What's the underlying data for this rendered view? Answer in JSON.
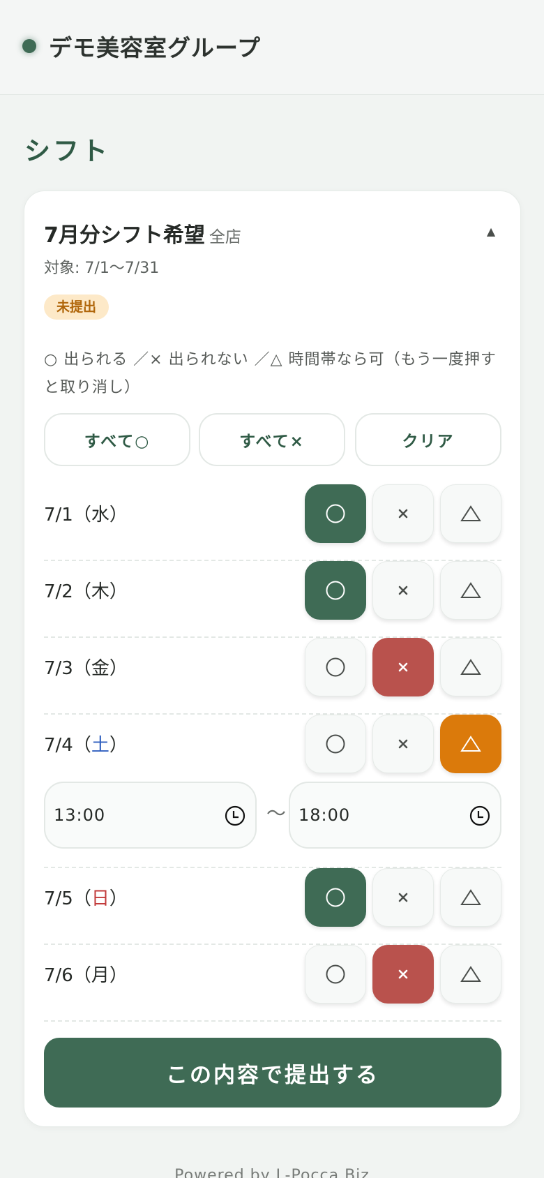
{
  "header": {
    "brand_name": "デモ美容室グループ"
  },
  "page": {
    "title": "シフト"
  },
  "card": {
    "title": "7月分シフト希望",
    "scope": "全店",
    "target": "対象: 7/1〜7/31",
    "status_badge": "未提出",
    "legend": "○ 出られる ／× 出られない ／△ 時間帯なら可（もう一度押すと取り消し）",
    "bulk_buttons": {
      "all_ok": "すべて○",
      "all_ng": "すべて×",
      "clear": "クリア"
    },
    "days": [
      {
        "date": "7/1",
        "weekday": "水",
        "selected": "ok"
      },
      {
        "date": "7/2",
        "weekday": "木",
        "selected": "ok"
      },
      {
        "date": "7/3",
        "weekday": "金",
        "selected": "ng"
      },
      {
        "date": "7/4",
        "weekday": "土",
        "selected": "partial"
      },
      {
        "date": "7/5",
        "weekday": "日",
        "selected": "ok"
      },
      {
        "date": "7/6",
        "weekday": "月",
        "selected": "ng"
      }
    ],
    "partial_time": {
      "start": "13:00",
      "separator": "〜",
      "end": "18:00"
    },
    "submit_label": "この内容で提出する"
  },
  "footer": {
    "text": "Powered by L-Pocca Biz"
  },
  "colors": {
    "accent": "#3f6b55",
    "ng": "#b9524d",
    "partial": "#db7a0b",
    "saturday": "#2f5fbf",
    "sunday": "#c23b3b",
    "badge_bg": "#fde9c8",
    "badge_text": "#b0660a"
  }
}
